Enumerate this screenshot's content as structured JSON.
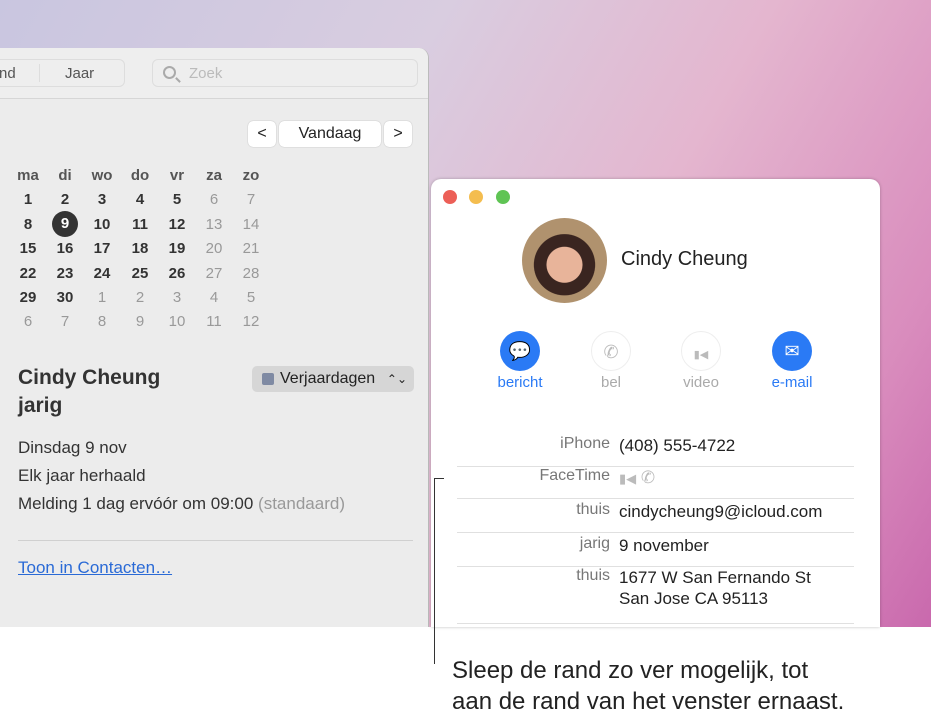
{
  "calendar": {
    "toolbar": {
      "month_partial": "nd",
      "year": "Jaar",
      "search_placeholder": "Zoek"
    },
    "nav": {
      "prev": "<",
      "today": "Vandaag",
      "next": ">"
    },
    "weekdays": [
      "ma",
      "di",
      "wo",
      "do",
      "vr",
      "za",
      "zo"
    ],
    "weeks": [
      [
        "1",
        "2",
        "3",
        "4",
        "5",
        "6",
        "7"
      ],
      [
        "8",
        "9",
        "10",
        "11",
        "12",
        "13",
        "14"
      ],
      [
        "15",
        "16",
        "17",
        "18",
        "19",
        "20",
        "21"
      ],
      [
        "22",
        "23",
        "24",
        "25",
        "26",
        "27",
        "28"
      ],
      [
        "29",
        "30",
        "1",
        "2",
        "3",
        "4",
        "5"
      ],
      [
        "6",
        "7",
        "8",
        "9",
        "10",
        "11",
        "12"
      ]
    ],
    "today": "9",
    "event": {
      "title_line1": "Cindy Cheung",
      "title_line2": "jarig",
      "calendar": "Verjaardagen",
      "calendar_color": "#7f8aa3",
      "date": "Dinsdag 9 nov",
      "repeat": "Elk jaar herhaald",
      "alert": "Melding 1 dag ervóór om 09:00",
      "alert_note": "(standaard)",
      "link": "Toon in Contacten…"
    }
  },
  "contact": {
    "name": "Cindy Cheung",
    "actions": [
      {
        "label": "bericht",
        "icon": "message-icon",
        "enabled": true
      },
      {
        "label": "bel",
        "icon": "phone-icon",
        "enabled": false
      },
      {
        "label": "video",
        "icon": "video-icon",
        "enabled": false
      },
      {
        "label": "e-mail",
        "icon": "mail-icon",
        "enabled": true
      }
    ],
    "fields": [
      {
        "label": "iPhone",
        "value": "(408) 555-4722"
      },
      {
        "label": "FaceTime",
        "value": ""
      },
      {
        "label": "thuis",
        "value": "cindycheung9@icloud.com"
      },
      {
        "label": "jarig",
        "value": "9 november"
      },
      {
        "label": "thuis",
        "value": "1677 W San Fernando St",
        "value2": "San Jose CA 95113"
      }
    ],
    "accent": "#2a7af5"
  },
  "caption": {
    "line1": "Sleep de rand zo ver mogelijk, tot",
    "line2": "aan de rand van het venster ernaast."
  }
}
